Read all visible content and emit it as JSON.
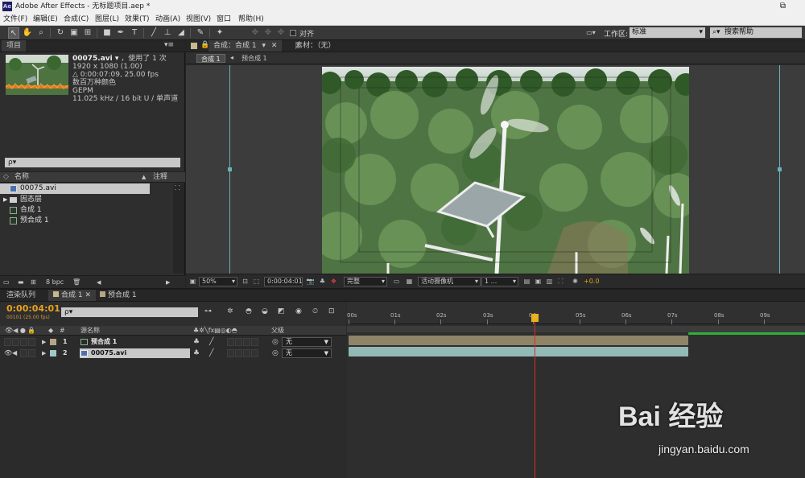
{
  "window": {
    "app_icon": "Ae",
    "title": "Adobe After Effects - 无标题项目.aep *",
    "restore_symbol": "⧉"
  },
  "menu": [
    "文件(F)",
    "编辑(E)",
    "合成(C)",
    "图层(L)",
    "效果(T)",
    "动画(A)",
    "视图(V)",
    "窗口",
    "帮助(H)"
  ],
  "toolbar": {
    "snap_label": "对齐",
    "workspace_label": "工作区:",
    "workspace_value": "标准",
    "search_placeholder": "搜索帮助"
  },
  "project_panel": {
    "tab": "项目",
    "menu_glyph": "▾≡",
    "file_name": "00075.avi ▾",
    "used": "，使用了 1 次",
    "resolution": "1920 x 1080 (1.00)",
    "duration": "△ 0:00:07:09, 25.00 fps",
    "colors": "数百万种颜色",
    "codec": "GEPM",
    "audio": "11.025 kHz / 16 bit U / 单声道",
    "search": "ρ▾",
    "columns": {
      "name": "名称",
      "comment": "注释"
    },
    "items": [
      {
        "name": "00075.avi",
        "type": "footage",
        "selected": true
      },
      {
        "name": "固态层",
        "type": "folder",
        "selected": false
      },
      {
        "name": "合成 1",
        "type": "comp",
        "selected": false
      },
      {
        "name": "预合成 1",
        "type": "comp",
        "selected": false
      }
    ],
    "bpc": "8 bpc"
  },
  "comp_panel": {
    "tab": "合成：合成 1",
    "footage_tab": "素材：（无）",
    "crumbs": [
      "合成 1",
      "预合成 1"
    ],
    "zoom": "50%",
    "timecode": "0:00:04:01",
    "resolution": "完整",
    "camera": "活动摄像机",
    "views": "1 ...",
    "exposure": "+0.0"
  },
  "timeline": {
    "tabs": [
      "渲染队列",
      "合成 1",
      "预合成 1"
    ],
    "timecode": "0:00:04:01",
    "frame_info": "00101 (25.00 fps)",
    "search": "ρ▾",
    "col_source": "源名称",
    "col_parent": "父级",
    "layers": [
      {
        "num": "1",
        "name": "预合成 1",
        "parent": "无",
        "label_color": "#b5a585",
        "type": "comp"
      },
      {
        "num": "2",
        "name": "00075.avi",
        "parent": "无",
        "label_color": "#9fc9c8",
        "type": "footage",
        "selected": true
      }
    ],
    "ruler": [
      "00s",
      "01s",
      "02s",
      "03s",
      "04s",
      "05s",
      "06s",
      "07s",
      "08s",
      "09s"
    ],
    "bar_colors": {
      "precomp": "#8f8468",
      "footage": "#92b9b6",
      "green": "#2fb03a"
    }
  },
  "watermark": {
    "logo": "Bai 经验",
    "url": "jingyan.baidu.com"
  }
}
